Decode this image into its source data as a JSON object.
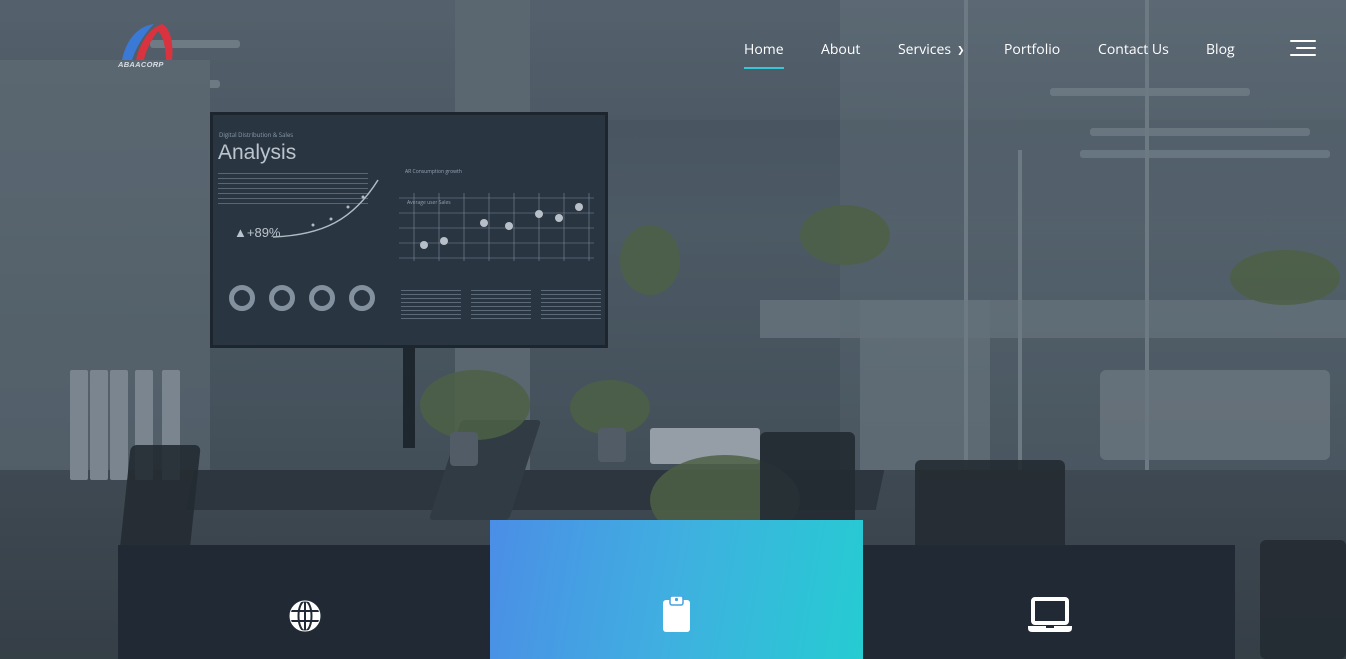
{
  "brand": {
    "logo_text": "ABAACORP"
  },
  "nav": {
    "items": [
      {
        "label": "Home",
        "active": true
      },
      {
        "label": "About"
      },
      {
        "label": "Services",
        "has_dropdown": true
      },
      {
        "label": "Portfolio"
      },
      {
        "label": "Contact Us"
      },
      {
        "label": "Blog"
      }
    ],
    "menu_icon": "hamburger-menu-icon",
    "active_underline_color": "#36c7d4"
  },
  "hero": {
    "monitor": {
      "subtitle": "Digital Distribution & Sales",
      "title": "Analysis",
      "growth": "▲+89%",
      "chart_caption": "Average user Sales",
      "legend_caption": "AR Consumption growth"
    }
  },
  "features": [
    {
      "icon": "globe-icon"
    },
    {
      "icon": "clipboard-icon",
      "highlighted": true
    },
    {
      "icon": "laptop-icon"
    }
  ],
  "colors": {
    "feature_dark": "#212a34",
    "feature_gradient_start": "#4b8ee6",
    "feature_gradient_end": "#25ccd2",
    "accent": "#36c7d4"
  }
}
